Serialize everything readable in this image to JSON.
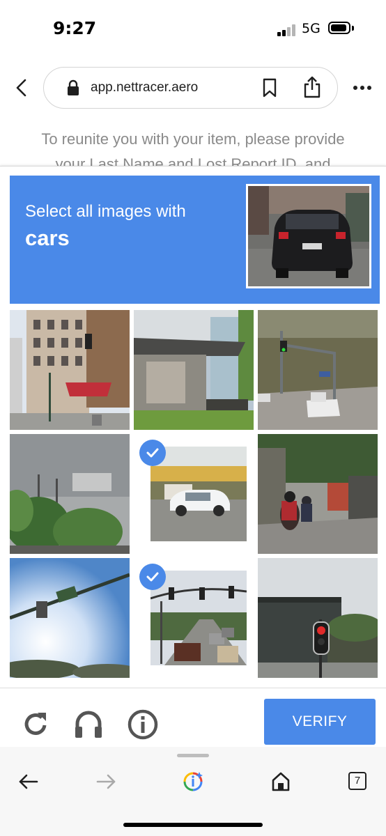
{
  "status_bar": {
    "time": "9:27",
    "network": "5G"
  },
  "browser": {
    "url": "app.nettracer.aero",
    "tab_count": "7"
  },
  "page": {
    "line1": "To reunite you with your item, please provide",
    "line2": "your Last Name and Lost Report ID, and"
  },
  "captcha": {
    "instruction": "Select all images with",
    "target": "cars",
    "tiles": [
      {
        "scene": "street corner building",
        "selected": false
      },
      {
        "scene": "loading dock",
        "selected": false
      },
      {
        "scene": "road with traffic light and truck",
        "selected": false
      },
      {
        "scene": "trees and billboard",
        "selected": false
      },
      {
        "scene": "parked white car",
        "selected": true
      },
      {
        "scene": "motorcyclists on street",
        "selected": false
      },
      {
        "scene": "traffic light against sky",
        "selected": false
      },
      {
        "scene": "street with cars and traffic lights",
        "selected": true
      },
      {
        "scene": "red traffic light near building",
        "selected": false
      }
    ],
    "verify_label": "VERIFY"
  },
  "icons": [
    "reload-icon",
    "headphones-icon",
    "info-icon",
    "back-icon",
    "forward-icon",
    "google-lens-icon",
    "home-icon",
    "more-icon",
    "bookmark-icon",
    "share-icon",
    "lock-icon"
  ],
  "colors": {
    "accent": "#4a89e8",
    "page_text": "#8a8a8a"
  }
}
